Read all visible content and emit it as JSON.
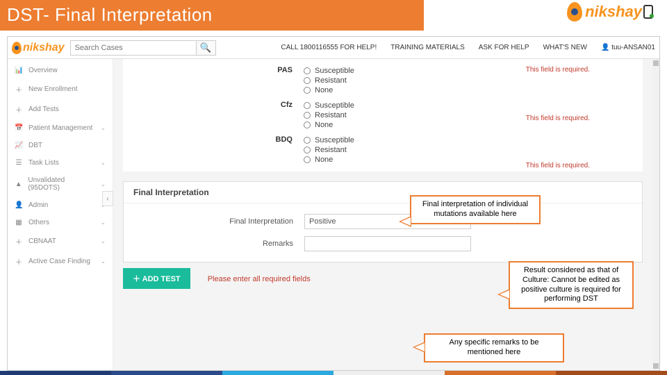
{
  "slide": {
    "title": "DST- Final Interpretation",
    "brand": "nikshay"
  },
  "topnav": {
    "search_placeholder": "Search Cases",
    "links": {
      "help_line": "CALL 1800116555 FOR HELP!",
      "training": "TRAINING MATERIALS",
      "ask": "ASK FOR HELP",
      "whatsnew": "WHAT'S NEW",
      "user": "tuu-ANSAN01"
    }
  },
  "sidebar": {
    "items": [
      {
        "icon": "📊",
        "label": "Overview"
      },
      {
        "icon": "＋",
        "label": "New Enrollment"
      },
      {
        "icon": "＋",
        "label": "Add Tests"
      },
      {
        "icon": "📅",
        "label": "Patient Management",
        "chev": true
      },
      {
        "icon": "📈",
        "label": "DBT"
      },
      {
        "icon": "☰",
        "label": "Task Lists",
        "chev": true
      },
      {
        "icon": "▲",
        "label": "Unvalidated (95DOTS)",
        "chev": true
      },
      {
        "icon": "👤",
        "label": "Admin",
        "chev": true
      },
      {
        "icon": "▦",
        "label": "Others",
        "chev": true
      },
      {
        "icon": "＋",
        "label": "CBNAAT",
        "chev": true
      },
      {
        "icon": "＋",
        "label": "Active Case Finding",
        "chev": true
      }
    ]
  },
  "drugs": [
    {
      "name": "PAS",
      "err": "This field is required."
    },
    {
      "name": "Cfz",
      "err": "This field is required."
    },
    {
      "name": "BDQ",
      "err": "This field is required."
    }
  ],
  "options": [
    "Susceptible",
    "Resistant",
    "None"
  ],
  "final": {
    "panel_title": "Final Interpretation",
    "fi_label": "Final Interpretation",
    "fi_value": "Positive",
    "remarks_label": "Remarks",
    "remarks_value": ""
  },
  "actions": {
    "add_test": "＋  ADD TEST",
    "required_msg": "Please enter all required fields"
  },
  "callouts": {
    "c1": "Final interpretation of individual mutations available here",
    "c2": "Result considered as that of Culture: Cannot be edited as positive culture is required for performing DST",
    "c3": "Any specific remarks to be mentioned here"
  }
}
